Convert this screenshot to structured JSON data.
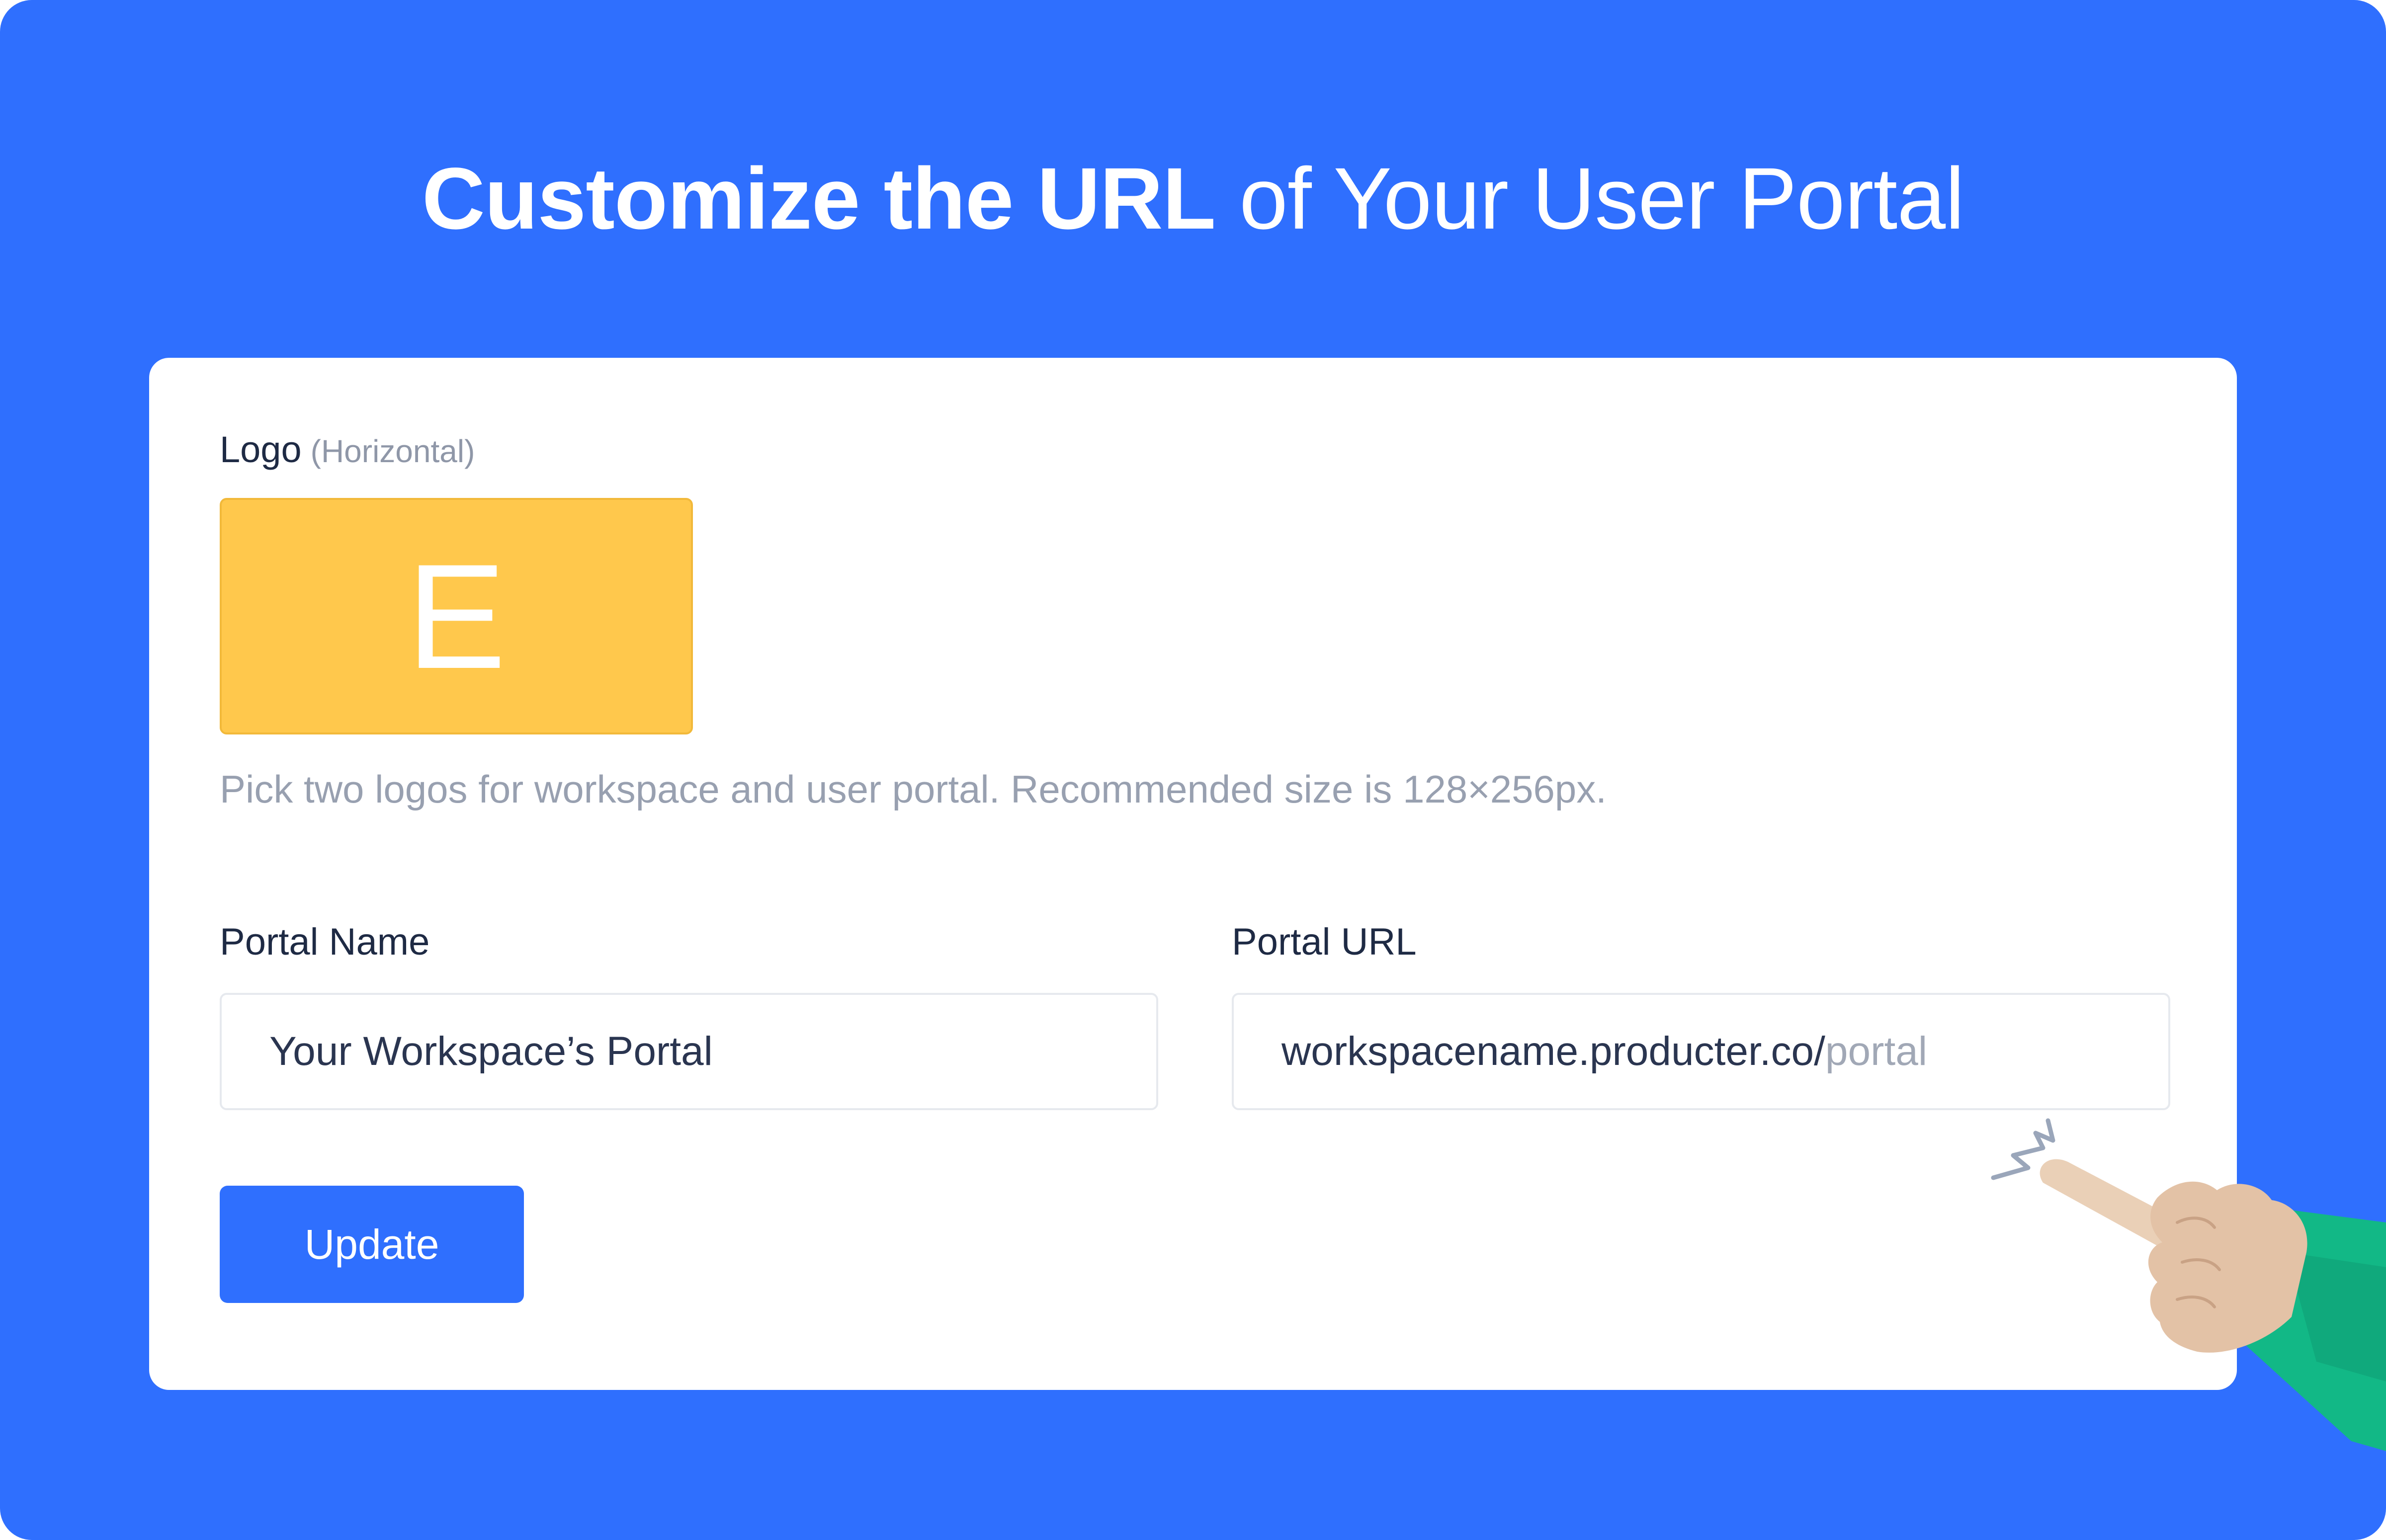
{
  "headline": {
    "bold": "Customize the URL",
    "light": "of Your User Portal"
  },
  "logo": {
    "label": "Logo",
    "sublabel": "(Horizontal)",
    "letter": "E",
    "color": "#FFC84C"
  },
  "helper_text": "Pick two logos for workspace and user portal. Recommended size is 128×256px.",
  "portal_name": {
    "label": "Portal Name",
    "value": "Your Workspace’s Portal"
  },
  "portal_url": {
    "label": "Portal URL",
    "value_prefix": "workspacename.producter.co/",
    "value_suffix": "portal"
  },
  "update_button": {
    "label": "Update"
  },
  "colors": {
    "background": "#2F6FFE",
    "card": "#FFFFFF",
    "accent": "#2F6FFE",
    "sleeve": "#12B886"
  },
  "icons": {
    "pointer": "pointing-hand-icon",
    "sparkle": "click-sparkle-icon"
  }
}
